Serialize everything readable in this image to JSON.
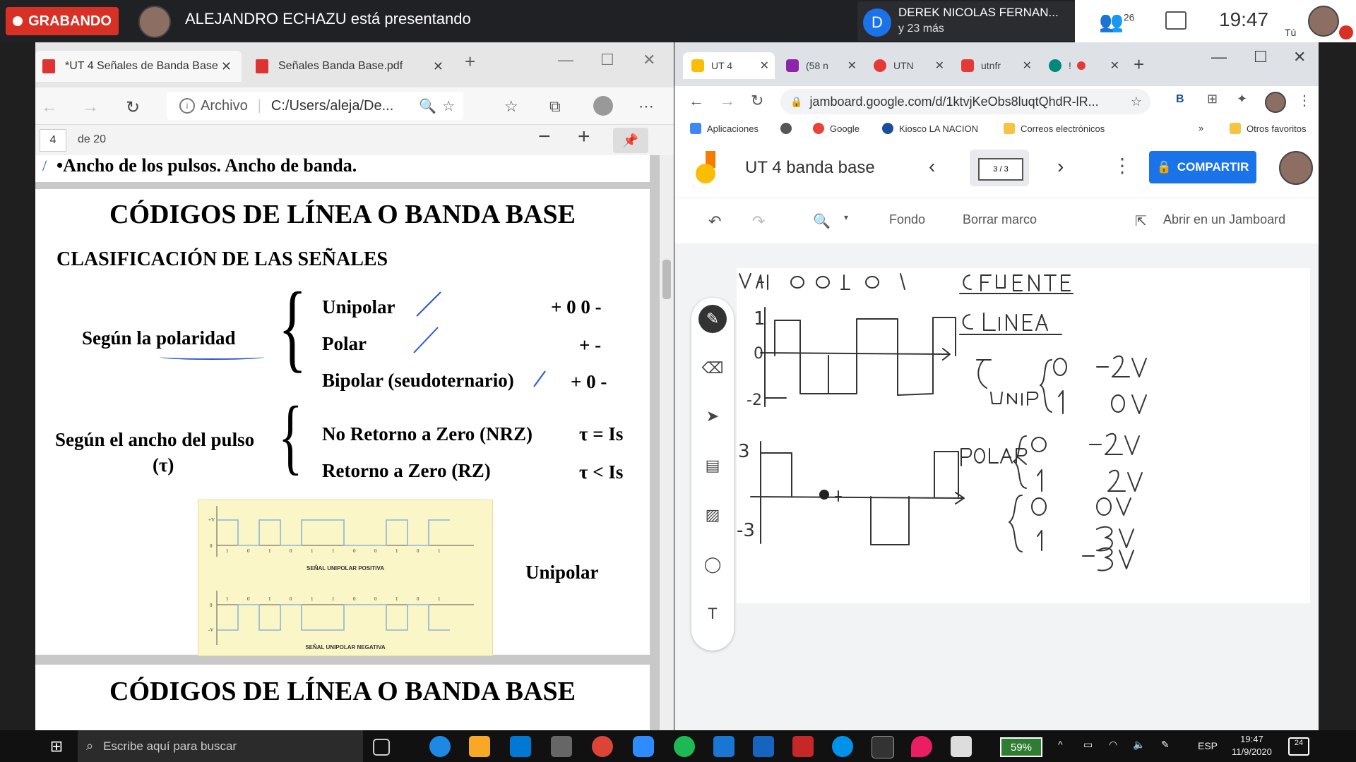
{
  "meet": {
    "recording_label": "GRABANDO",
    "presenter": "ALEJANDRO ECHAZU está presentando",
    "other_initial": "D",
    "other_name": "DEREK NICOLAS FERNAN...",
    "other_more": "y 23 más",
    "participants": "26",
    "clock": "19:47",
    "self_label": "Tú"
  },
  "edge": {
    "tabs": [
      {
        "label": "*UT 4 Señales de Banda Base"
      },
      {
        "label": "Señales Banda Base.pdf"
      }
    ],
    "address_scheme": "Archivo",
    "address": "C:/Users/aleja/De...",
    "page_number": "4",
    "page_of": "de 20"
  },
  "pdf": {
    "top_line": "•Ancho de los pulsos. Ancho de banda.",
    "title": "CÓDIGOS DE LÍNEA O BANDA BASE",
    "subtitle": "CLASIFICACIÓN DE LAS SEÑALES",
    "polarity_label": "Según la polaridad",
    "polarity_items": [
      {
        "name": "Unipolar",
        "code": "+ 0     0 -"
      },
      {
        "name": "Polar",
        "code": "+  -"
      },
      {
        "name": "Bipolar (seudoternario)",
        "code": "+ 0  -"
      }
    ],
    "width_label_1": "Según el ancho del pulso",
    "width_label_2": "(τ)",
    "width_items": [
      {
        "name": "No Retorno a Zero (NRZ)",
        "code": "τ = Is"
      },
      {
        "name": "Retorno a Zero (RZ)",
        "code": "τ < Is"
      }
    ],
    "diagram_caption_1": "SEÑAL UNIPOLAR POSITIVA",
    "diagram_caption_2": "SEÑAL UNIPOLAR NEGATIVA",
    "diagram_y_top_1": "+V",
    "diagram_y_zero": "0",
    "diagram_y_bot_2": "-V",
    "bits": [
      "1",
      "0",
      "1",
      "0",
      "1",
      "1",
      "0",
      "0",
      "1",
      "0",
      "1"
    ],
    "side_label": "Unipolar",
    "title_next": "CÓDIGOS DE LÍNEA O BANDA BASE"
  },
  "chrome": {
    "tabs": [
      {
        "label": "UT 4",
        "color": "#fbbc04"
      },
      {
        "label": "(58 n",
        "color": "#8e24aa"
      },
      {
        "label": "UTN",
        "color": "#e53935"
      },
      {
        "label": "utnfr",
        "color": "#e53935"
      },
      {
        "label": "!",
        "color": "#00897b"
      }
    ],
    "url": "jamboard.google.com/d/1ktvjKeObs8luqtQhdR-lR...",
    "bookmarks": [
      {
        "label": "Aplicaciones",
        "color": "#4285f4"
      },
      {
        "label": "",
        "color": "#555555"
      },
      {
        "label": "Google",
        "color": "#ea4335"
      },
      {
        "label": "Kiosco LA NACION",
        "color": "#1a4d9c"
      },
      {
        "label": "Correos electrónicos",
        "color": "#f6c343"
      }
    ],
    "bookmarks_more": "»",
    "bookmarks_other": "Otros favoritos"
  },
  "jamboard": {
    "title": "UT 4 banda base",
    "frame": "3 / 3",
    "share_label": "COMPARTIR",
    "toolbar": {
      "background": "Fondo",
      "clear": "Borrar marco",
      "open": "Abrir en un Jamboard"
    }
  },
  "taskbar": {
    "search_placeholder": "Escribe aquí para buscar",
    "battery": "59%",
    "lang": "ESP",
    "time": "19:47",
    "date": "11/9/2020",
    "notifications": "24"
  }
}
